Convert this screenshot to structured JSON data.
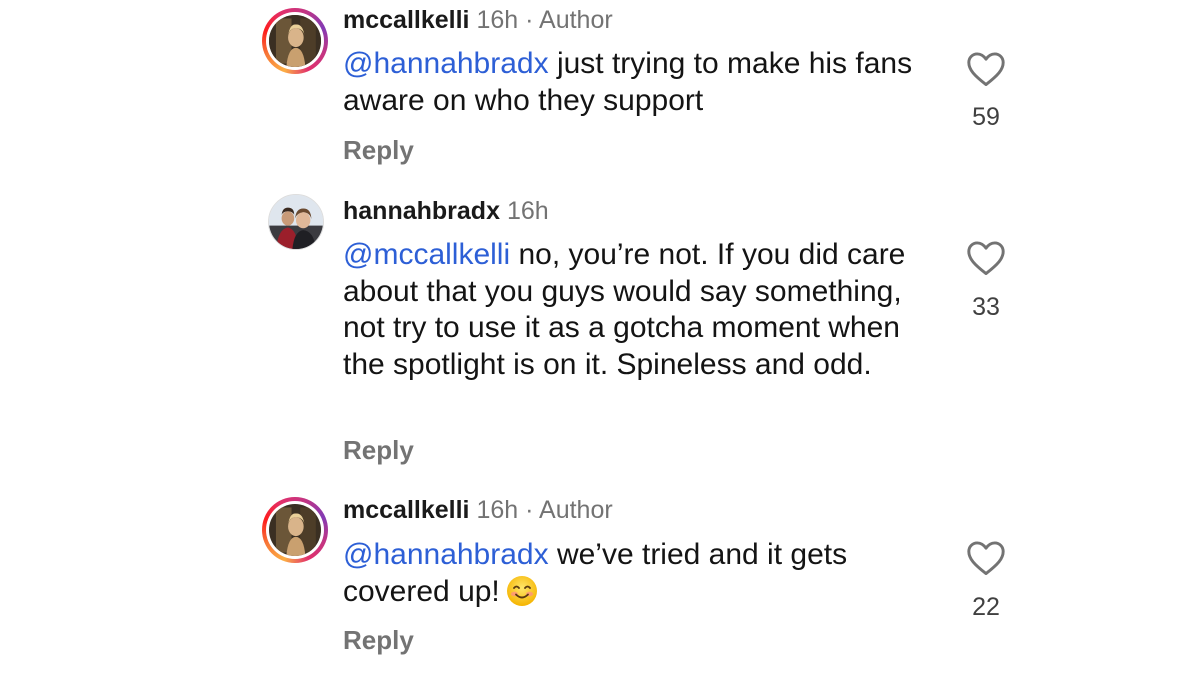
{
  "comments": [
    {
      "username": "mccallkelli",
      "time": "16h",
      "separator": "·",
      "badge": "Author",
      "mention": "@hannahbradx",
      "text": " just trying to make his fans aware on who they support",
      "reply_label": "Reply",
      "likes": "59"
    },
    {
      "username": "hannahbradx",
      "time": "16h",
      "mention": "@mccallkelli",
      "text": " no, you’re not. If you did care about that you guys would say something, not try to use it as a gotcha moment when the spotlight is on it. Spineless and odd.",
      "reply_label": "Reply",
      "likes": "33"
    },
    {
      "username": "mccallkelli",
      "time": "16h",
      "separator": "·",
      "badge": "Author",
      "mention": "@hannahbradx",
      "text": " we’ve tried and it gets covered up!",
      "emoji": "smiling-face-emoji",
      "reply_label": "Reply",
      "likes": "22"
    }
  ],
  "colors": {
    "mention": "#2d5fd6",
    "muted": "#737373",
    "story_ring": [
      "#fcaf45",
      "#fd1d1d",
      "#e1306c",
      "#c13584",
      "#833ab4"
    ]
  },
  "icons": {
    "like": "heart-outline-icon"
  }
}
